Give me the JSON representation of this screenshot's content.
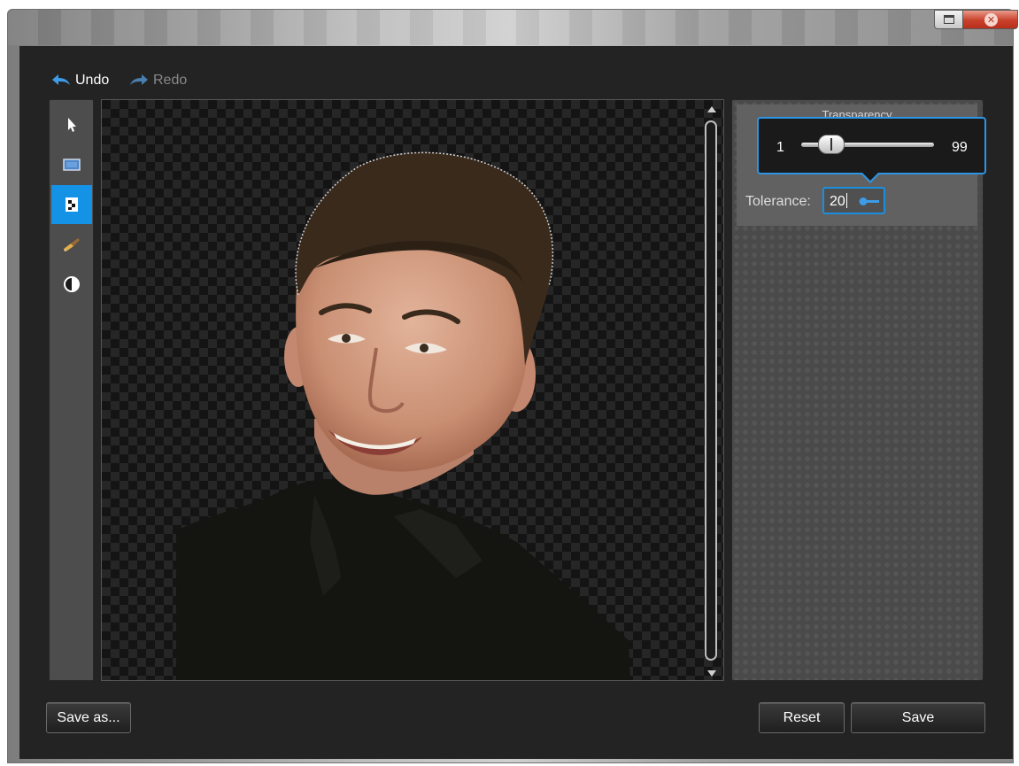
{
  "toolbar": {
    "undo_label": "Undo",
    "redo_label": "Redo"
  },
  "tools": [
    {
      "icon": "pointer-icon",
      "active": false
    },
    {
      "icon": "crop-icon",
      "active": false
    },
    {
      "icon": "transparency-icon",
      "active": true
    },
    {
      "icon": "brush-icon",
      "active": false
    },
    {
      "icon": "contrast-icon",
      "active": false
    }
  ],
  "panel": {
    "header": "Transparency",
    "tolerance_label": "Tolerance:",
    "tolerance_value": "20"
  },
  "slider": {
    "min": "1",
    "max": "99",
    "value": 20
  },
  "buttons": {
    "save_as": "Save as...",
    "reset": "Reset",
    "save": "Save"
  },
  "colors": {
    "accent": "#1492e6",
    "background": "#232323",
    "panel": "#4a4a4a"
  }
}
